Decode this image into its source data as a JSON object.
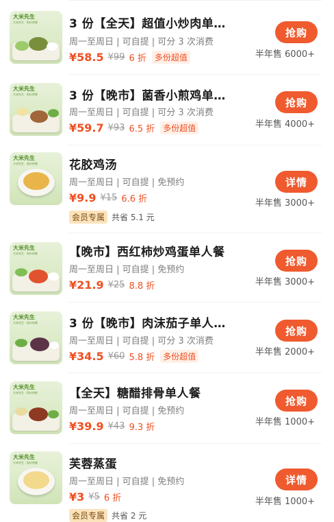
{
  "items": [
    {
      "title": "3 份【全天】超值小炒肉单…",
      "meta": "周一至周日 | 可自提 | 可分 3 次消费",
      "price": "¥58.5",
      "original": "¥99",
      "discount": "6 折",
      "tag": "多份超值",
      "button": "抢购",
      "sold": "半年售 6000+",
      "brand": "大米先生",
      "brand_sub": "大米先生 · 现炒快餐"
    },
    {
      "title": "3 份【晚市】菌香小煎鸡单…",
      "meta": "周一至周日 | 可自提 | 可分 3 次消费",
      "price": "¥59.7",
      "original": "¥93",
      "discount": "6.5 折",
      "tag": "多份超值",
      "button": "抢购",
      "sold": "半年售 4000+",
      "brand": "大米先生",
      "brand_sub": "大米先生 · 现炒快餐"
    },
    {
      "title": "花胶鸡汤",
      "meta": "周一至周日 | 可自提 | 免预约",
      "price": "¥9.9",
      "original": "¥15",
      "discount": "6.6 折",
      "member_tag": "会员专属",
      "saving": "共省 5.1 元",
      "button": "详情",
      "sold": "半年售 3000+",
      "brand": "大米先生",
      "brand_sub": "大米先生 · 现炒快餐"
    },
    {
      "title": "【晚市】西红柿炒鸡蛋单人餐",
      "meta": "周一至周日 | 可自提 | 免预约",
      "price": "¥21.9",
      "original": "¥25",
      "discount": "8.8 折",
      "button": "抢购",
      "sold": "半年售 3000+",
      "brand": "大米先生",
      "brand_sub": "大米先生 · 现炒快餐"
    },
    {
      "title": "3 份【晚市】肉沫茄子单人…",
      "meta": "周一至周日 | 可自提 | 可分 3 次消费",
      "price": "¥34.5",
      "original": "¥60",
      "discount": "5.8 折",
      "tag": "多份超值",
      "button": "抢购",
      "sold": "半年售 2000+",
      "brand": "大米先生",
      "brand_sub": "大米先生 · 现炒快餐"
    },
    {
      "title": "【全天】糖醋排骨单人餐",
      "meta": "周一至周日 | 可自提 | 免预约",
      "price": "¥39.9",
      "original": "¥43",
      "discount": "9.3 折",
      "button": "抢购",
      "sold": "半年售 1000+",
      "brand": "大米先生",
      "brand_sub": "大米先生 · 现炒快餐"
    },
    {
      "title": "芙蓉蒸蛋",
      "meta": "周一至周日 | 可自提 | 免预约",
      "price": "¥3",
      "original": "¥5",
      "discount": "6 折",
      "member_tag": "会员专属",
      "saving": "共省 2 元",
      "button": "详情",
      "sold": "半年售 1000+",
      "brand": "大米先生",
      "brand_sub": "大米先生 · 现炒快餐"
    }
  ],
  "colors": {
    "accent": "#ef4f21",
    "button": "#ef5a2e",
    "tag_bg": "#fff0e8",
    "member_bg": "#fbe3bb"
  }
}
